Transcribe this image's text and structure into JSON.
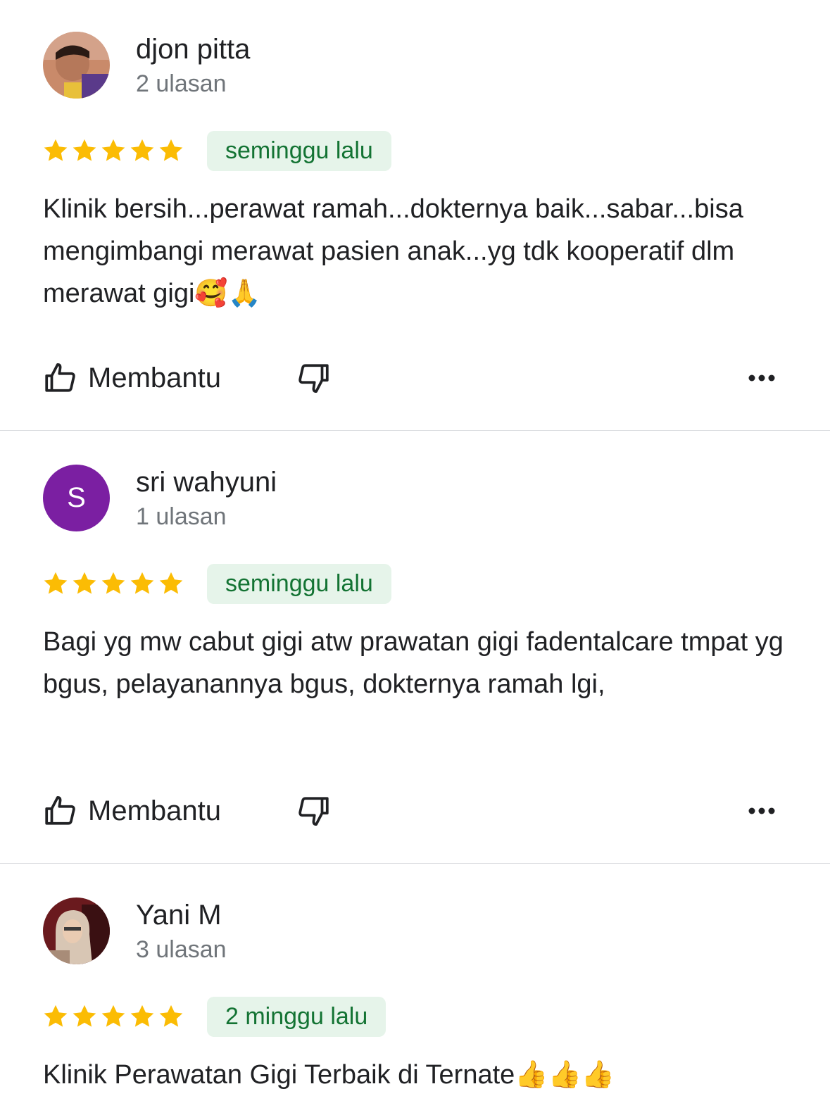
{
  "reviews": [
    {
      "name": "djon pitta",
      "count": "2 ulasan",
      "rating": 5,
      "date": "seminggu lalu",
      "text": "Klinik bersih...perawat ramah...dokternya baik...sabar...bisa mengimbangi merawat pasien anak...yg tdk kooperatif dlm merawat gigi🥰🙏",
      "helpful_label": "Membantu",
      "avatar": "photo"
    },
    {
      "name": "sri wahyuni",
      "count": "1 ulasan",
      "rating": 5,
      "date": "seminggu lalu",
      "text": "Bagi yg mw cabut gigi atw prawatan gigi fadentalcare tmpat yg bgus, pelayanannya bgus, dokternya ramah lgi,",
      "helpful_label": "Membantu",
      "avatar": "letter",
      "avatar_letter": "S",
      "avatar_color": "#7b1fa2"
    },
    {
      "name": "Yani M",
      "count": "3 ulasan",
      "rating": 5,
      "date": "2 minggu lalu",
      "text": "Klinik Perawatan Gigi Terbaik di Ternate👍👍👍",
      "avatar": "photo"
    }
  ],
  "colors": {
    "star": "#fbbc04",
    "badge_bg": "#e6f4ea",
    "badge_text": "#137333",
    "divider": "#dadce0"
  },
  "icons": {
    "helpful": "thumbs-up-icon",
    "not_helpful": "thumbs-down-icon",
    "more": "more-horizontal-icon"
  }
}
